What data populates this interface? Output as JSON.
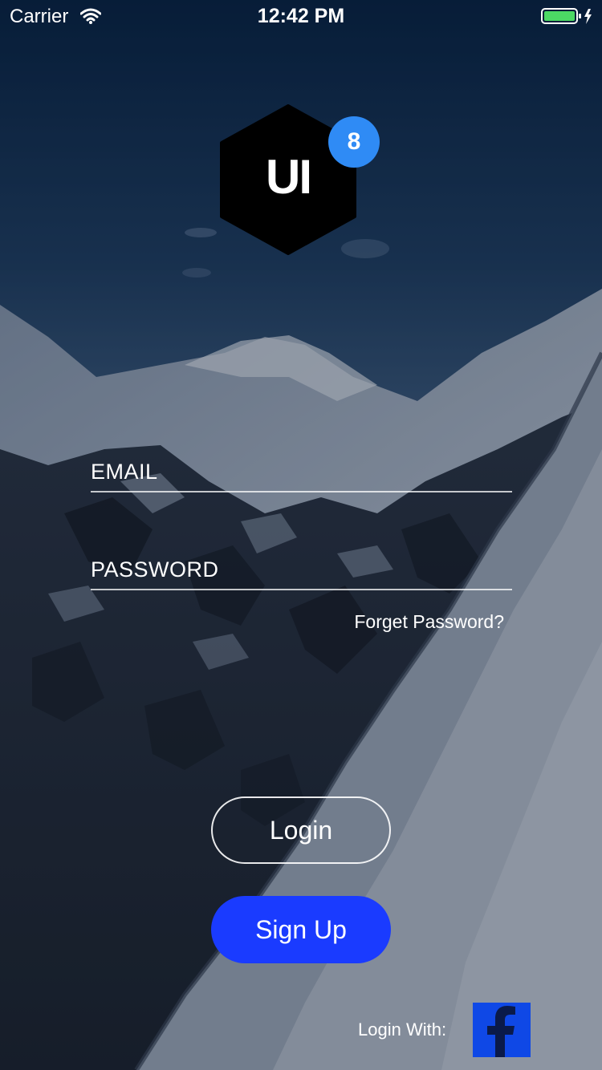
{
  "status_bar": {
    "carrier": "Carrier",
    "time": "12:42 PM"
  },
  "logo": {
    "text": "UI",
    "badge": "8"
  },
  "form": {
    "email_placeholder": "EMAIL",
    "email_value": "",
    "password_placeholder": "PASSWORD",
    "password_value": "",
    "forgot_password": "Forget Password?"
  },
  "actions": {
    "login_label": "Login",
    "signup_label": "Sign Up",
    "login_with_label": "Login With:",
    "social_icon": "facebook-icon"
  },
  "colors": {
    "signup_button": "#1a3bff",
    "badge": "#2f8bf5",
    "facebook": "#0f48e6",
    "battery": "#4cd964"
  }
}
